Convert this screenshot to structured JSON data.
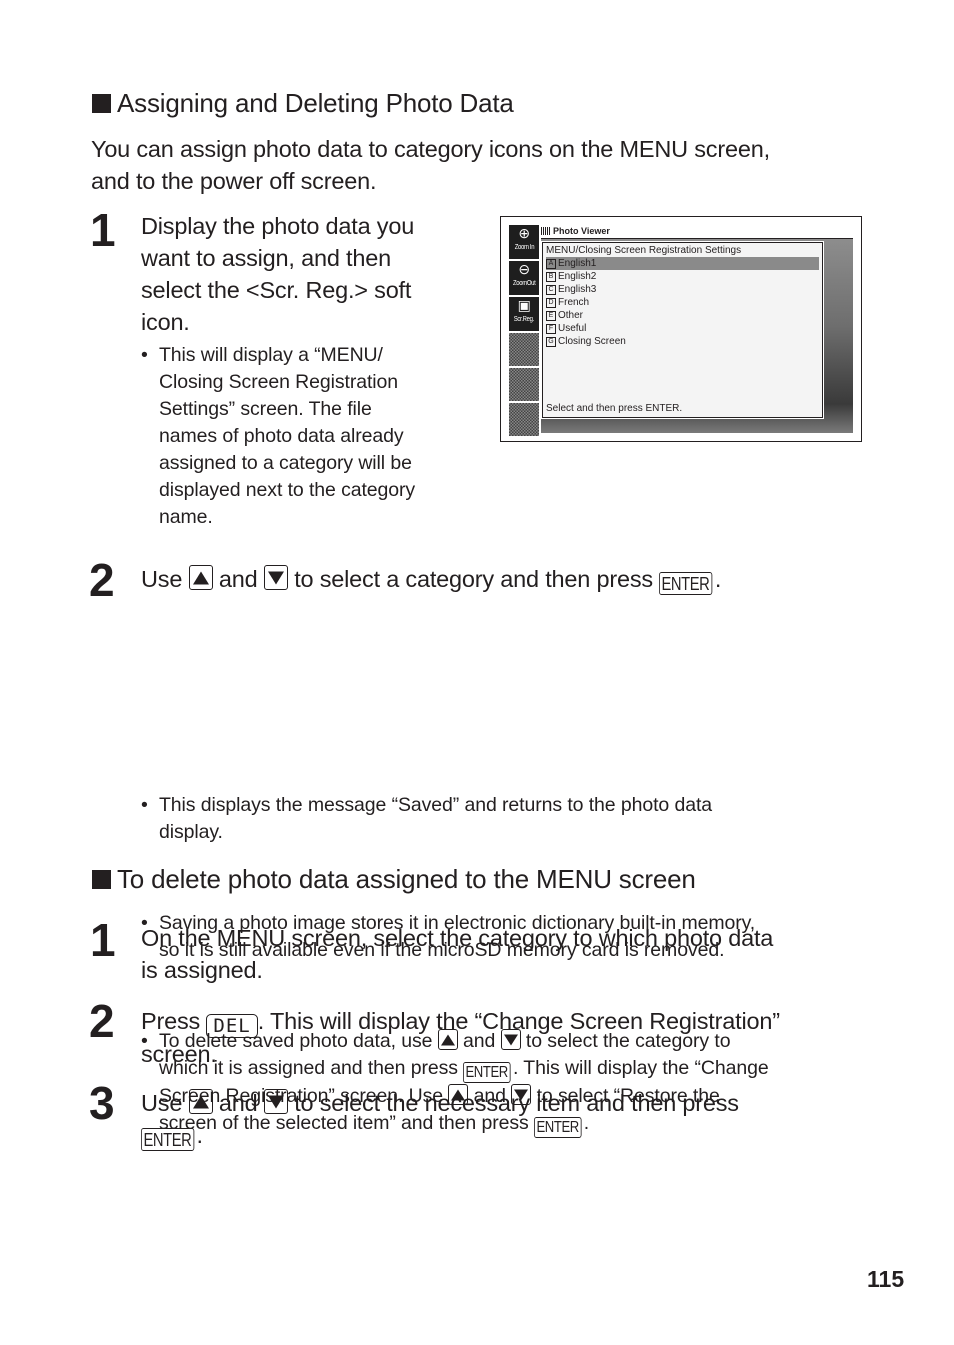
{
  "section1": {
    "heading": "Assigning and Deleting Photo Data",
    "intro_line1": "You can assign photo data to category icons on the MENU screen,",
    "intro_line2": "and to the power off screen.",
    "step1": {
      "number": "1",
      "lines": [
        "Display the photo data you",
        "want to assign, and then",
        "select the <Scr. Reg.> soft",
        "icon."
      ],
      "bullet_lines": [
        "This will display a “MENU/",
        "Closing Screen  Registration",
        "Settings” screen. The file",
        "names of photo data already",
        "assigned to a category will be",
        "displayed next to the category",
        "name."
      ]
    },
    "step2": {
      "number": "2",
      "text_use": "Use",
      "text_and": "and",
      "text_rest": "to select a category and then press",
      "text_end": ".",
      "bullets": [
        {
          "lines": [
            "This displays the message “Saved” and returns to the photo data",
            "display."
          ]
        },
        {
          "lines": [
            "Saving a photo image stores it in electronic dictionary built-in memory,",
            "so it is still available even if the microSD memory card is removed."
          ]
        }
      ],
      "bullet3": {
        "l1_a": "To delete saved photo data, use",
        "l1_b": "and",
        "l1_c": "to select the category to",
        "l2_a": "which it is assigned and then press",
        "l2_b": ". This will display the “Change",
        "l3_a": "Screen Registration” screen. Use",
        "l3_b": "and",
        "l3_c": "to select “Restore the",
        "l4_a": "screen of the selected item” and then press",
        "l4_b": "."
      }
    }
  },
  "section2": {
    "heading": "To delete photo data assigned to the MENU screen",
    "step1": {
      "number": "1",
      "lines": [
        "On the MENU screen, select the category to which photo data",
        "is assigned."
      ]
    },
    "step2": {
      "number": "2",
      "text_a": "Press",
      "text_b": ". This will display the “Change Screen Registration”",
      "line2": "screen."
    },
    "step3": {
      "number": "3",
      "text_use": "Use",
      "text_and": "and",
      "text_rest": "to select the necessary item and then press",
      "text_end": "."
    }
  },
  "keys": {
    "enter": "ENTER",
    "del": "DEL",
    "up_icon": "up-arrow-key-icon",
    "down_icon": "down-arrow-key-icon"
  },
  "device_screen": {
    "app_title": "Photo Viewer",
    "soft_icons": [
      {
        "label": "Zoom In",
        "icon": "zoom-in-icon",
        "glyph": "⊕"
      },
      {
        "label": "ZoomOut",
        "icon": "zoom-out-icon",
        "glyph": "⊖"
      },
      {
        "label": "Scr.Reg.",
        "icon": "screen-register-icon",
        "glyph": "▣"
      }
    ],
    "dialog_title": "MENU/Closing Screen Registration Settings",
    "items": [
      {
        "letter": "A",
        "label": "English1",
        "selected": true
      },
      {
        "letter": "B",
        "label": "English2",
        "selected": false
      },
      {
        "letter": "C",
        "label": "English3",
        "selected": false
      },
      {
        "letter": "D",
        "label": "French",
        "selected": false
      },
      {
        "letter": "E",
        "label": "Other",
        "selected": false
      },
      {
        "letter": "F",
        "label": "Useful",
        "selected": false
      },
      {
        "letter": "G",
        "label": "Closing Screen",
        "selected": false
      }
    ],
    "footer": "Select and then press ENTER."
  },
  "page_number": "115"
}
